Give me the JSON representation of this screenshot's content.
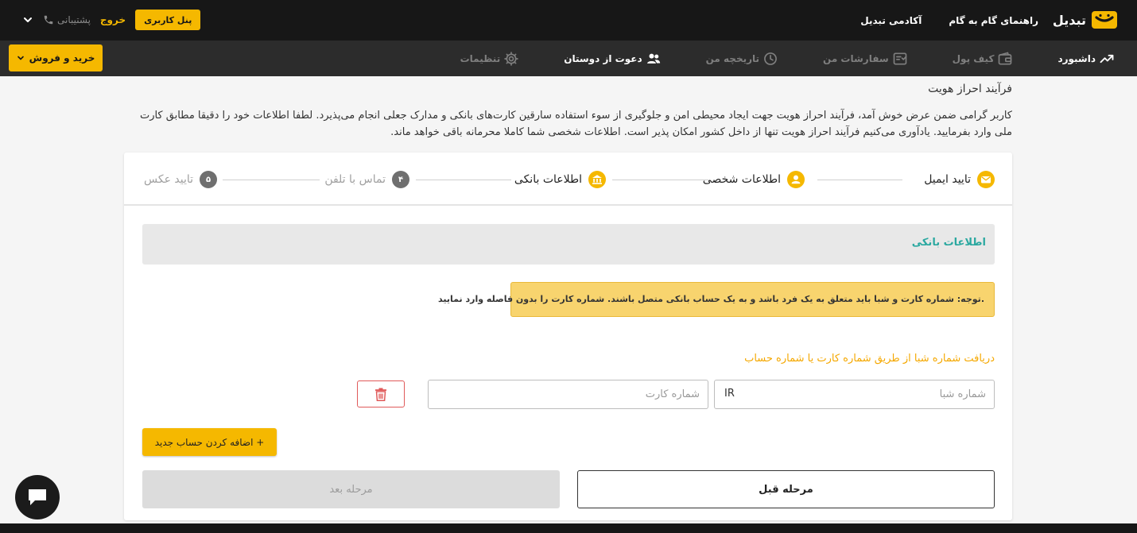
{
  "header": {
    "brand": "تبدیل",
    "links": [
      "راهنمای گام به گام",
      "آکادمی تبدیل"
    ],
    "support": "پشتیبانی",
    "logout": "خروج",
    "panel": "پنل کاربری"
  },
  "nav": {
    "items": [
      {
        "label": "داشبورد",
        "icon": "chart-icon"
      },
      {
        "label": "کیف پول",
        "icon": "wallet-icon"
      },
      {
        "label": "سفارشات من",
        "icon": "orders-icon"
      },
      {
        "label": "تاریخچه من",
        "icon": "history-icon"
      },
      {
        "label": "دعوت از دوستان",
        "icon": "users-icon"
      },
      {
        "label": "تنظیمات",
        "icon": "gear-icon"
      }
    ],
    "active": "دعوت از دوستان",
    "trade_button": "خرید و فروش"
  },
  "intro": {
    "title": "فرآیند احراز هویت",
    "text": "کاربر گرامی ضمن عرض خوش آمد، فرآیند احراز هویت جهت ایجاد محیطی امن و جلوگیری از سوء استفاده سارقین کارت‌های بانکی و مدارک جعلی انجام می‌پذیرد. لطفا اطلاعات خود را دقیقا مطابق کارت ملی وارد بفرمایید. یادآوری می‌کنیم فرآیند احراز هویت تنها از داخل کشور امکان پذیر است. اطلاعات شخصی شما کاملا محرمانه باقی خواهد ماند."
  },
  "steps": [
    {
      "label": "تایید ایمیل",
      "state": "done",
      "icon": "envelope-icon"
    },
    {
      "label": "اطلاعات شخصی",
      "state": "done",
      "icon": "user-icon"
    },
    {
      "label": "اطلاعات بانکی",
      "state": "done",
      "icon": "bank-icon"
    },
    {
      "label": "تماس با تلفن",
      "state": "todo",
      "number": "۴"
    },
    {
      "label": "تایید عکس",
      "state": "todo",
      "number": "۵"
    }
  ],
  "bank": {
    "section_title": "اطلاعات بانکی",
    "notice": "توجه: شماره کارت و شبا باید متعلق به یک فرد باشد و به یک حساب بانکی متصل باشند. شماره کارت را بدون فاصله وارد نمایید.",
    "form_label": "دریافت شماره شبا از طریق شماره کارت یا شماره حساب",
    "sheba_placeholder": "شماره شبا",
    "sheba_prefix": "IR",
    "card_placeholder": "شماره کارت",
    "add_button": "اضافه کردن حساب جدید +",
    "next_button": "مرحله بعد",
    "prev_button": "مرحله قبل"
  },
  "colors": {
    "accent": "#f5b800",
    "topbar": "#171717",
    "navbar": "#2c2c2c",
    "section_title": "#2aa8a0",
    "form_label": "#f5a800",
    "danger": "#e05a5a"
  }
}
